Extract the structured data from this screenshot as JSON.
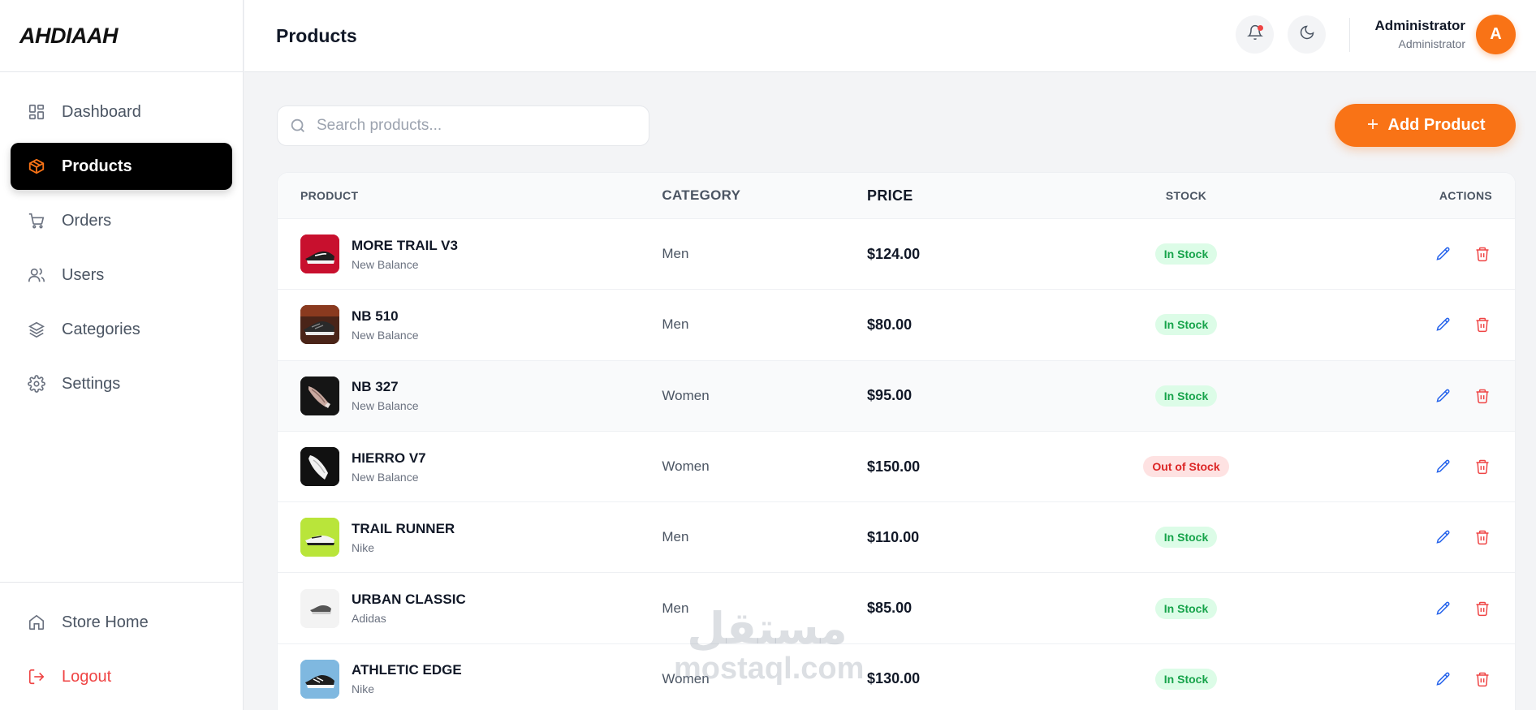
{
  "brand": {
    "name": "AHDIAAH"
  },
  "sidebar": {
    "items": [
      {
        "label": "Dashboard",
        "icon": "dashboard-icon",
        "active": false
      },
      {
        "label": "Products",
        "icon": "package-icon",
        "active": true
      },
      {
        "label": "Orders",
        "icon": "cart-icon",
        "active": false
      },
      {
        "label": "Users",
        "icon": "users-icon",
        "active": false
      },
      {
        "label": "Categories",
        "icon": "layers-icon",
        "active": false
      },
      {
        "label": "Settings",
        "icon": "gear-icon",
        "active": false
      }
    ],
    "bottom": [
      {
        "label": "Store Home",
        "icon": "home-icon"
      },
      {
        "label": "Logout",
        "icon": "logout-icon"
      }
    ]
  },
  "header": {
    "title": "Products",
    "user": {
      "name": "Administrator",
      "role": "Administrator",
      "initial": "A"
    }
  },
  "toolbar": {
    "search_placeholder": "Search products...",
    "add_label": "Add Product"
  },
  "table": {
    "columns": {
      "product": "PRODUCT",
      "category": "CATEGORY",
      "price": "PRICE",
      "stock": "STOCK",
      "actions": "ACTIONS"
    },
    "rows": [
      {
        "name": "MORE TRAIL V3",
        "brand": "New Balance",
        "category": "Men",
        "price": "$124.00",
        "stock": "In Stock",
        "in_stock": true
      },
      {
        "name": "NB 510",
        "brand": "New Balance",
        "category": "Men",
        "price": "$80.00",
        "stock": "In Stock",
        "in_stock": true
      },
      {
        "name": "NB 327",
        "brand": "New Balance",
        "category": "Women",
        "price": "$95.00",
        "stock": "In Stock",
        "in_stock": true
      },
      {
        "name": "HIERRO V7",
        "brand": "New Balance",
        "category": "Women",
        "price": "$150.00",
        "stock": "Out of Stock",
        "in_stock": false
      },
      {
        "name": "TRAIL RUNNER",
        "brand": "Nike",
        "category": "Men",
        "price": "$110.00",
        "stock": "In Stock",
        "in_stock": true
      },
      {
        "name": "URBAN CLASSIC",
        "brand": "Adidas",
        "category": "Men",
        "price": "$85.00",
        "stock": "In Stock",
        "in_stock": true
      },
      {
        "name": "ATHLETIC EDGE",
        "brand": "Nike",
        "category": "Women",
        "price": "$130.00",
        "stock": "In Stock",
        "in_stock": true
      }
    ]
  },
  "watermark": {
    "arabic": "مستقل",
    "latin": "mostaql.com"
  },
  "colors": {
    "accent": "#f97316",
    "in_stock": "#16a34a",
    "out_of_stock": "#dc2626",
    "edit": "#2563eb",
    "delete": "#ef4444"
  }
}
